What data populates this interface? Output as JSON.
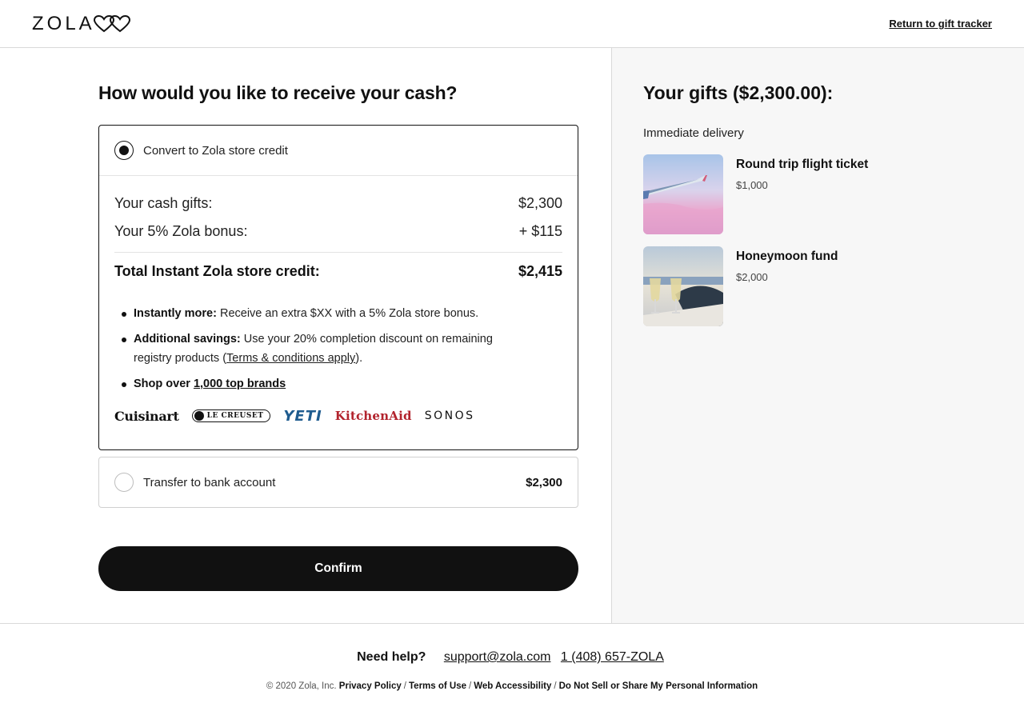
{
  "header": {
    "logo_text": "ZOLA",
    "return_link": "Return to gift tracker"
  },
  "main": {
    "title": "How would you like to receive your cash?",
    "option_credit": {
      "label": "Convert to Zola store credit",
      "selected": true,
      "cash_gifts_label": "Your cash gifts:",
      "cash_gifts_value": "$2,300",
      "bonus_label": "Your 5% Zola bonus:",
      "bonus_value": "+ $115",
      "total_label": "Total Instant Zola store credit:",
      "total_value": "$2,415",
      "bullets": {
        "b1_bold": "Instantly more:",
        "b1_text": " Receive an extra $XX with a 5% Zola store bonus.",
        "b2_bold": "Additional savings:",
        "b2_text": " Use your 20% completion discount on remaining registry products (",
        "b2_link": "Terms & conditions apply",
        "b2_end": ").",
        "b3_bold": "Shop over ",
        "b3_link": "1,000 top brands"
      },
      "brands": [
        "Cuisinart",
        "LE CREUSET",
        "YETI",
        "KitchenAid",
        "SONOS"
      ]
    },
    "option_bank": {
      "label": "Transfer to bank account",
      "amount": "$2,300",
      "selected": false
    },
    "confirm_label": "Confirm"
  },
  "sidebar": {
    "title": "Your gifts ($2,300.00):",
    "delivery_label": "Immediate delivery",
    "gifts": [
      {
        "name": "Round trip flight ticket",
        "price": "$1,000"
      },
      {
        "name": "Honeymoon fund",
        "price": "$2,000"
      }
    ]
  },
  "footer": {
    "help_label": "Need help?",
    "email": "support@zola.com",
    "phone": "1 (408) 657-ZOLA",
    "copyright": "© 2020 Zola, Inc.",
    "links": [
      "Privacy Policy",
      "Terms of Use",
      "Web Accessibility",
      "Do Not Sell or Share My Personal Information"
    ]
  },
  "colors": {
    "primary": "#111111",
    "sidebar_bg": "#f7f7f7",
    "yeti_blue": "#1f5c8f",
    "kitchenaid_red": "#b2232d"
  }
}
